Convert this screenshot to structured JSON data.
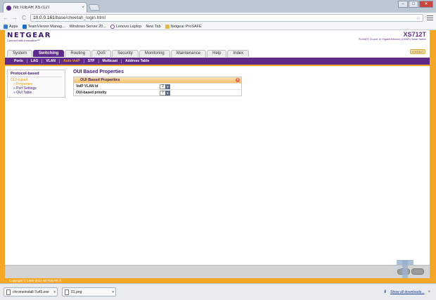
{
  "browser": {
    "tab_title": "NETGEAR XS712T",
    "tab_close": "×",
    "window_controls": {
      "minimize": "–",
      "maximize": "□",
      "close": "✕"
    },
    "url_host": "10.0.0.161",
    "url_path": "/base/cheetah_login.html",
    "back_glyph": "←",
    "forward_glyph": "→",
    "reload_glyph": "C",
    "star_glyph": "☆",
    "bookmarks": [
      {
        "label": "Apps",
        "icon": "apps-icon"
      },
      {
        "label": "TeamViewer Manag...",
        "icon": "teamviewer-icon"
      },
      {
        "label": "Windows Server 20...",
        "icon": "page-icon"
      },
      {
        "label": "Lenovo Laptop",
        "icon": "lenovo-icon"
      },
      {
        "label": "New Tab",
        "icon": "page-icon"
      },
      {
        "label": "Netgear ProSAFE",
        "icon": "folder-icon"
      }
    ]
  },
  "header": {
    "logo": "NETGEAR",
    "logo_tagline": "Connect with Innovation™",
    "model_name": "XS712T",
    "model_desc": "ProSAFE 10-port 10 Gigabit Ethernet (10GbE) Smart Switch",
    "logout": "LOGOUT"
  },
  "main_tabs": [
    {
      "label": "System",
      "active": false
    },
    {
      "label": "Switching",
      "active": true
    },
    {
      "label": "Routing",
      "active": false
    },
    {
      "label": "QoS",
      "active": false
    },
    {
      "label": "Security",
      "active": false
    },
    {
      "label": "Monitoring",
      "active": false
    },
    {
      "label": "Maintenance",
      "active": false
    },
    {
      "label": "Help",
      "active": false
    },
    {
      "label": "Index",
      "active": false
    }
  ],
  "sub_nav": [
    {
      "label": "Ports",
      "active": false
    },
    {
      "label": "LAG",
      "active": false
    },
    {
      "label": "VLAN",
      "active": false
    },
    {
      "label": "Auto-VoIP",
      "active": true
    },
    {
      "label": "STP",
      "active": false
    },
    {
      "label": "Multicast",
      "active": false
    },
    {
      "label": "Address Table",
      "active": false
    }
  ],
  "side_nav": {
    "heading": "Protocol-based",
    "subheading": "OUI-based",
    "items": [
      {
        "label": "» Properties",
        "active": true
      },
      {
        "label": "» Port Settings",
        "active": false
      },
      {
        "label": "» OUI Table",
        "active": false
      }
    ]
  },
  "content": {
    "page_title": "OUI Based Properties",
    "panel_title": "OUI Based Properties",
    "help_glyph": "?",
    "rows": [
      {
        "label": "VoIP VLAN Id",
        "value": "2"
      },
      {
        "label": "OUI-based priority",
        "value": "7"
      }
    ]
  },
  "footer": {
    "copyright": "Copyright © 1996-2013 NETGEAR ®"
  },
  "downloads": {
    "items": [
      {
        "name": "chromeinstall-7u45.exe"
      },
      {
        "name": "01.png"
      }
    ],
    "show_all": "Show all downloads...",
    "close_glyph": "×"
  },
  "colors": {
    "netgear_purple": "#5f2a8a",
    "netgear_orange": "#f4a624"
  }
}
